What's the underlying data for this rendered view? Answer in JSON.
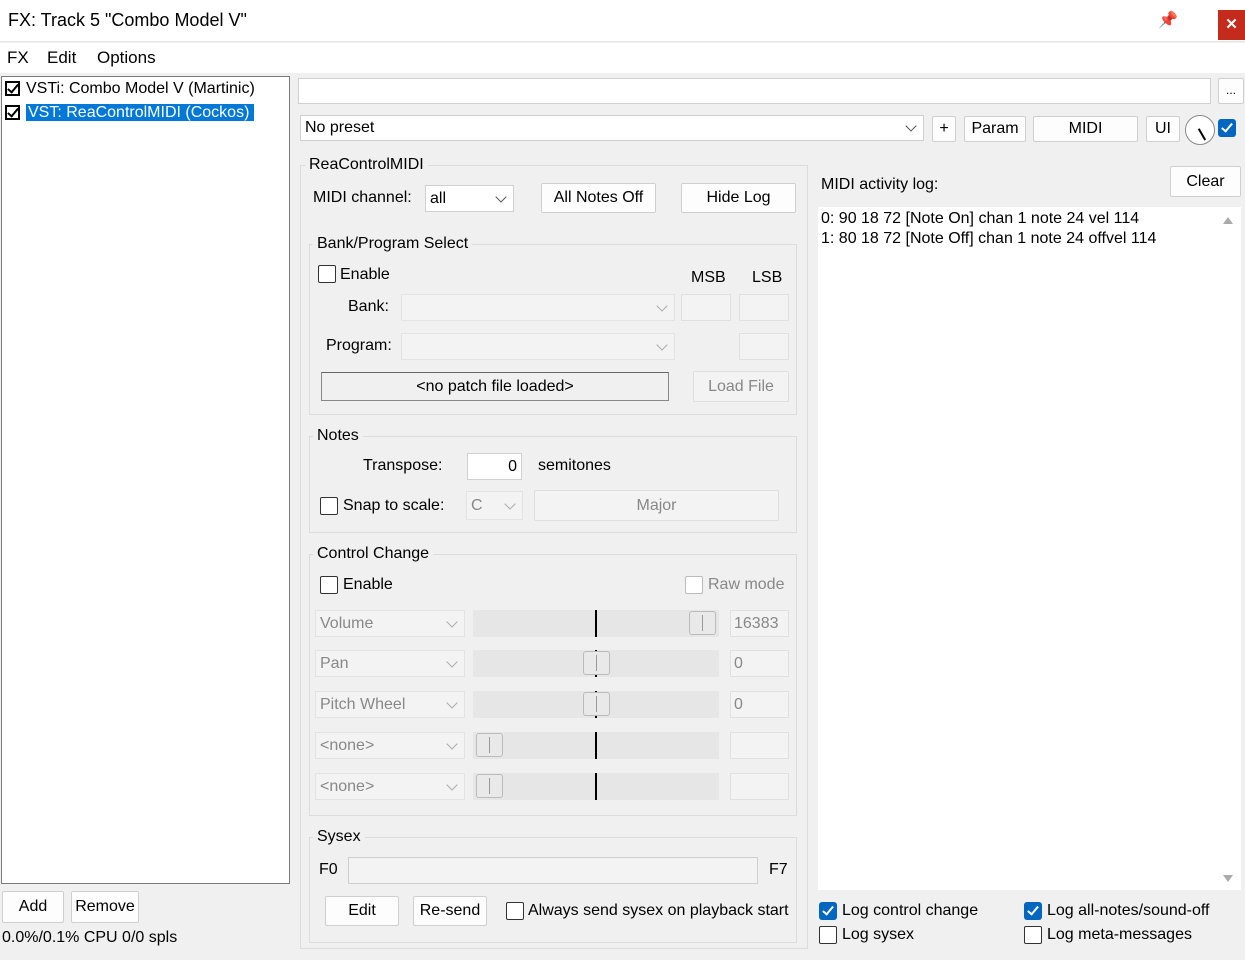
{
  "window": {
    "title": "FX: Track 5 \"Combo Model V\"",
    "close_glyph": "✕",
    "pin_glyph": "📌"
  },
  "menu": [
    "FX",
    "Edit",
    "Options"
  ],
  "fx_list": [
    {
      "label": "VSTi: Combo Model V (Martinic)",
      "checked": true,
      "selected": false
    },
    {
      "label": "VST: ReaControlMIDI (Cockos)",
      "checked": true,
      "selected": true
    }
  ],
  "left_buttons": {
    "add": "Add",
    "remove": "Remove"
  },
  "status": "0.0%/0.1% CPU 0/0 spls",
  "toolbar": {
    "ellipsis": "...",
    "preset": "No preset",
    "plus": "+",
    "param": "Param",
    "midi": "MIDI",
    "ui": "UI"
  },
  "plugin": {
    "name": "ReaControlMIDI",
    "midi_channel_label": "MIDI channel:",
    "midi_channel_value": "all",
    "all_notes_off": "All Notes Off",
    "hide_log": "Hide Log",
    "bank": {
      "group_label": "Bank/Program Select",
      "enable_label": "Enable",
      "msb": "MSB",
      "lsb": "LSB",
      "bank_label": "Bank:",
      "program_label": "Program:",
      "patch_file": "<no patch file loaded>",
      "load_file": "Load File"
    },
    "notes": {
      "group_label": "Notes",
      "transpose_label": "Transpose:",
      "transpose_value": "0",
      "semitones": "semitones",
      "snap_label": "Snap to scale:",
      "key": "C",
      "scale": "Major"
    },
    "cc": {
      "group_label": "Control Change",
      "enable_label": "Enable",
      "raw_mode": "Raw mode",
      "rows": [
        {
          "name": "Volume",
          "value": "16383",
          "level": 1.0
        },
        {
          "name": "Pan",
          "value": "0",
          "level": 0.5
        },
        {
          "name": "Pitch Wheel",
          "value": "0",
          "level": 0.5
        },
        {
          "name": "<none>",
          "value": "",
          "level": 0.0
        },
        {
          "name": "<none>",
          "value": "",
          "level": 0.0
        }
      ]
    },
    "sysex": {
      "group_label": "Sysex",
      "f0": "F0",
      "f7": "F7",
      "edit": "Edit",
      "resend": "Re-send",
      "always_send": "Always send sysex on playback start"
    }
  },
  "log": {
    "title": "MIDI activity log:",
    "clear": "Clear",
    "lines": [
      "0: 90 18 72 [Note On] chan 1 note 24 vel 114",
      "1: 80 18 72 [Note Off] chan 1 note 24 offvel 114"
    ],
    "options": {
      "log_cc": "Log control change",
      "log_sysex": "Log sysex",
      "log_all_notes": "Log all-notes/sound-off",
      "log_meta": "Log meta-messages"
    }
  },
  "colors": {
    "selection": "#0078d7",
    "close": "#c42b1c",
    "checkbox_on": "#0067c0"
  }
}
